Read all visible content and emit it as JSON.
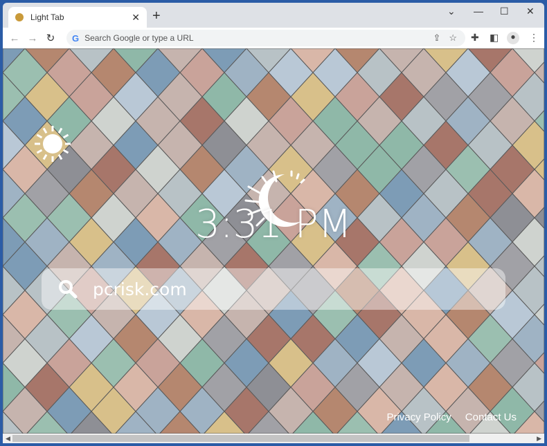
{
  "browser": {
    "tab_title": "Light Tab",
    "omnibox_placeholder": "Search Google or type a URL"
  },
  "page": {
    "time": "3:31 PM",
    "search_value": "pcrisk.com",
    "footer_links": [
      "Privacy Policy",
      "Contact Us"
    ]
  },
  "icons": {
    "weather": "sun-icon",
    "logo": "crescent-moon-icon",
    "search": "magnifier-icon"
  }
}
